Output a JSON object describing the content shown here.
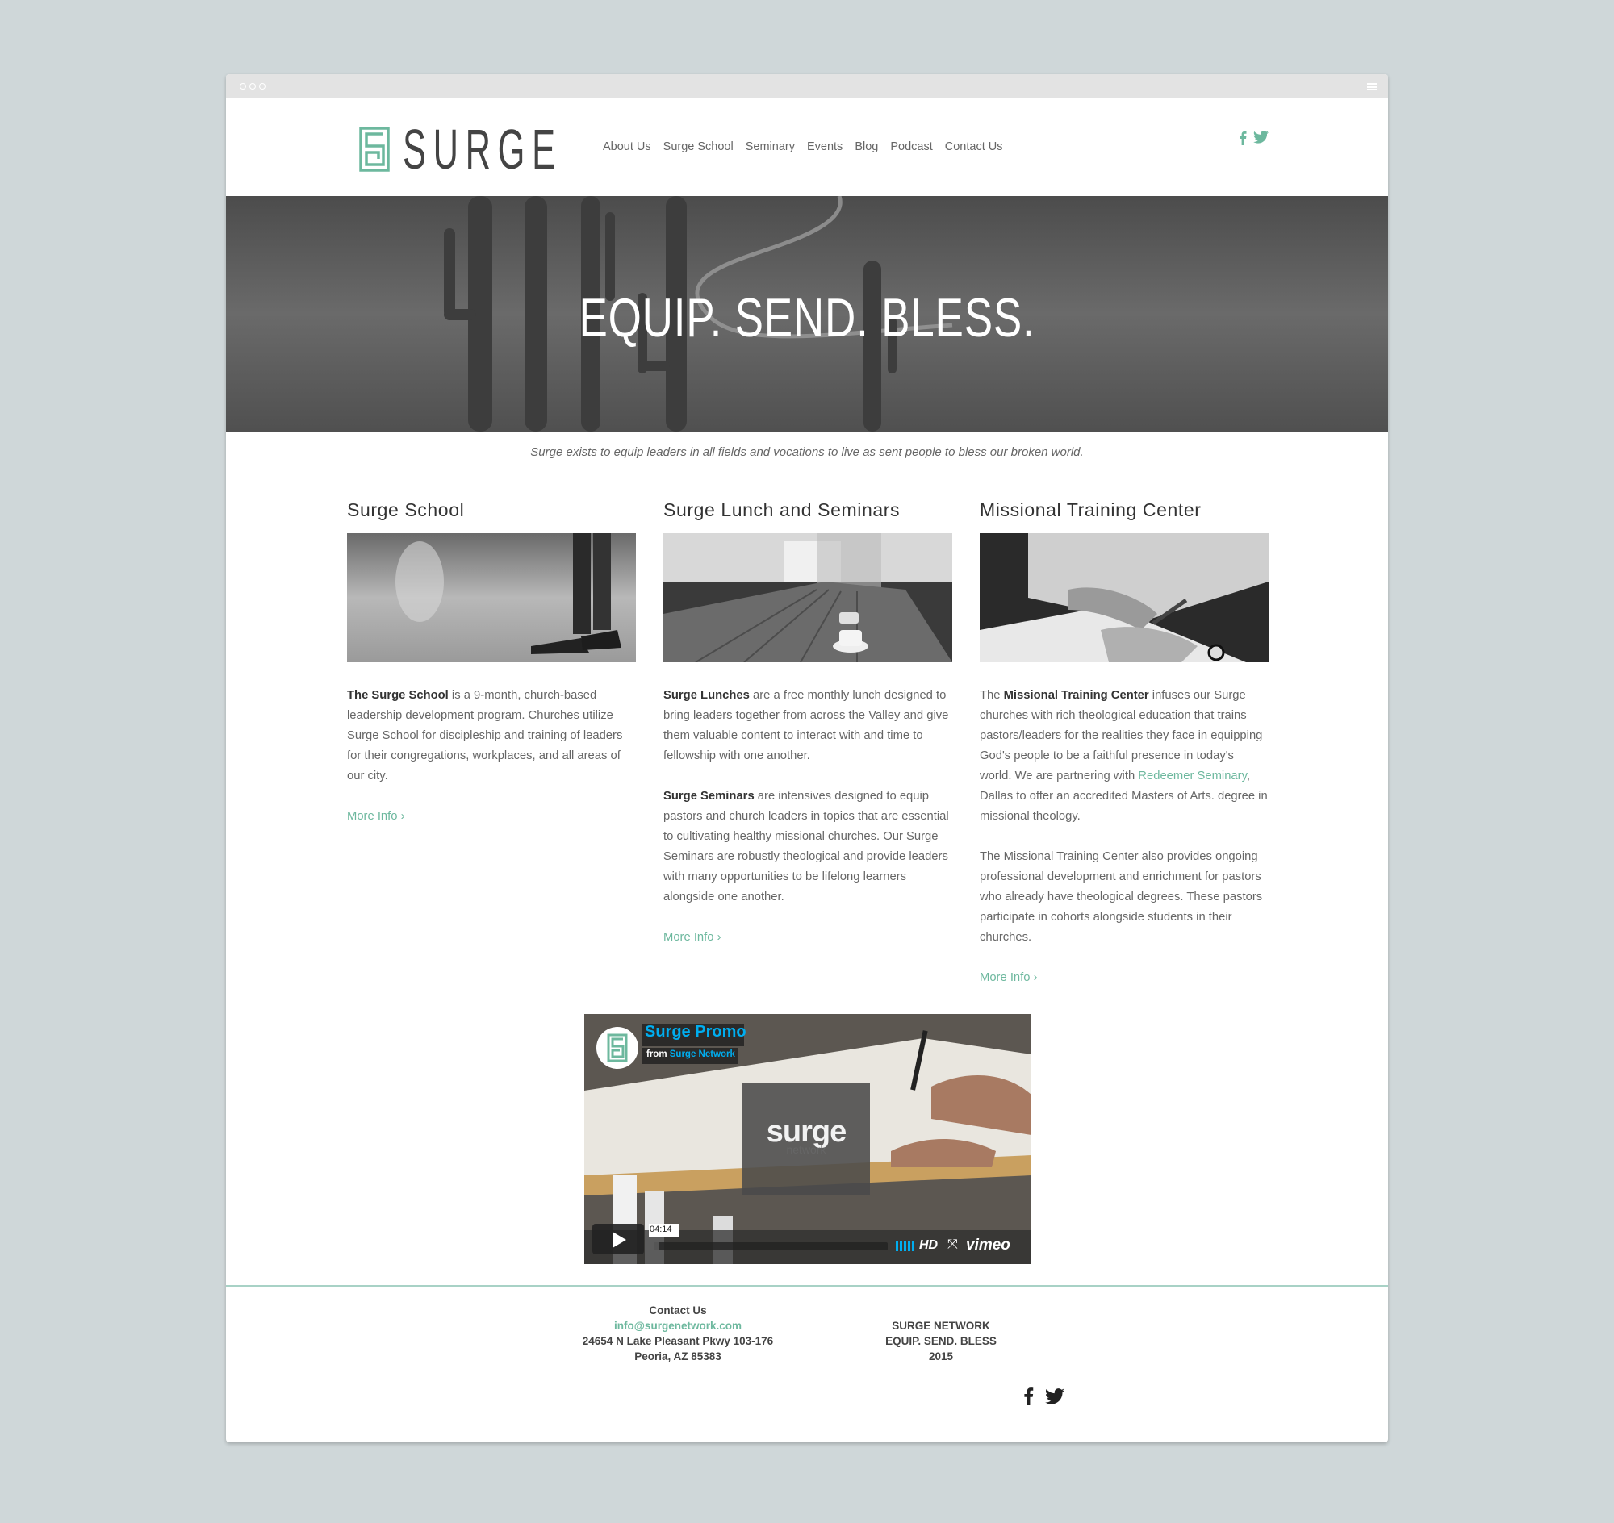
{
  "brand": {
    "name": "SURGE",
    "accent": "#6db89e"
  },
  "nav": {
    "items": [
      "About Us",
      "Surge School",
      "Seminary",
      "Events",
      "Blog",
      "Podcast",
      "Contact Us"
    ]
  },
  "hero": {
    "title": "EQUIP. SEND. BLESS."
  },
  "tagline": "Surge exists to equip leaders in all fields and vocations to live as sent people to bless our broken world.",
  "columns": [
    {
      "title": "Surge School",
      "p1_strong": "The Surge School",
      "p1_text": " is a 9-month, church-based leadership development program. Churches utilize Surge School for discipleship and training of leaders for their congregations, workplaces, and all areas of our city.",
      "more": "More Info ›"
    },
    {
      "title": "Surge Lunch and Seminars",
      "p1_strong": "Surge Lunches",
      "p1_text": " are a free monthly lunch designed to bring leaders together from across the Valley and give them valuable content to interact with and time to fellowship with one another.",
      "p2_strong": "Surge Seminars",
      "p2_text": " are intensives designed to equip pastors and church leaders in topics that are essential to cultivating healthy missional churches. Our Surge Seminars are robustly theological and provide leaders with many opportunities to be lifelong learners alongside one another.",
      "more": "More Info ›"
    },
    {
      "title": "Missional Training Center",
      "p1_pre": "The ",
      "p1_strong": "Missional Training Center",
      "p1_text": " infuses our Surge churches with rich theological education that trains pastors/leaders for the realities they face in equipping God's people to be a faithful presence in today's world. We are partnering with ",
      "p1_link": "Redeemer Seminary",
      "p1_post": ", Dallas to offer an accredited Masters of Arts. degree in missional theology.",
      "p2_text": "The Missional Training Center also provides ongoing professional development and enrichment for pastors who already have theological degrees. These pastors participate in cohorts alongside students in their churches.",
      "more": "More Info ›"
    }
  ],
  "video": {
    "title": "Surge Promo",
    "from_label": "from",
    "from_name": "Surge Network",
    "overlay_word": "surge",
    "overlay_sub": "network",
    "duration": "04:14",
    "hd": "HD",
    "provider": "vimeo"
  },
  "footer": {
    "contact_heading": "Contact Us",
    "email": "info@surgenetwork.com",
    "address1": "24654 N Lake Pleasant Pkwy 103-176",
    "address2": "Peoria, AZ 85383",
    "org": "SURGE NETWORK",
    "motto": "EQUIP. SEND. BLESS",
    "year": "2015"
  }
}
